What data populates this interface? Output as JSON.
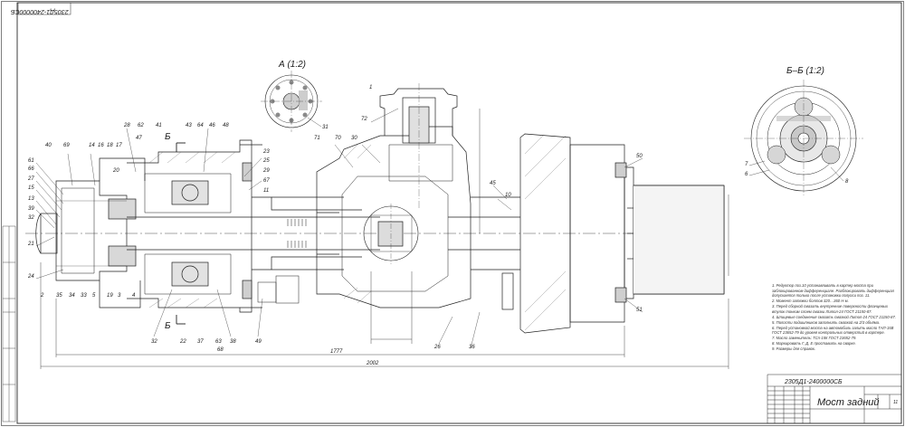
{
  "document": {
    "code_top": "2305Д1-2400000СБ",
    "code_titleblock": "2305Д1-2400000СБ",
    "title": "Мост задний",
    "sheets": "11"
  },
  "views": {
    "view_a": "А (1:2)",
    "view_bb": "Б–Б (1:2)",
    "section_mark": "Б"
  },
  "dimensions": {
    "d1": "1777",
    "d2": "2002"
  },
  "part_numbers": {
    "left_group": [
      "61",
      "66",
      "27",
      "15",
      "13",
      "39",
      "32",
      "21",
      "24"
    ],
    "top_left": [
      "40",
      "69",
      "14",
      "16",
      "18",
      "17",
      "20"
    ],
    "top_mid": [
      "28",
      "62",
      "47",
      "41",
      "43",
      "64",
      "46",
      "48"
    ],
    "right_mid": [
      "23",
      "25",
      "29",
      "67",
      "11"
    ],
    "bottom": [
      "2",
      "35",
      "34",
      "33",
      "5",
      "19",
      "3",
      "4"
    ],
    "bottom_mid": [
      "32",
      "22",
      "37",
      "63",
      "38",
      "68",
      "49"
    ],
    "diff": [
      "71",
      "70",
      "30",
      "72",
      "1"
    ],
    "right": [
      "45",
      "10",
      "50",
      "51",
      "26",
      "36"
    ],
    "view_a": [
      "31"
    ],
    "view_bb": [
      "7",
      "6",
      "8"
    ]
  },
  "notes": [
    "1. Редуктор поз.10 устанавливать в картер моста при заблокированном дифференциале. Разблокировать дифференциал допускается только после установки полуоси поз. 11.",
    "2. Момент затяжки болтов 320…360 Н·м.",
    "3. Перед сборкой смазать внутренние поверхности фланцевых втулок тонким слоем смазки Литол-24 ГОСТ 21150-87.",
    "4. Шлицевые соединения смазать смазкой Литол-24 ГОСТ 21150-87.",
    "5. Полости подшипников заполнить смазкой на 2/3 объёма.",
    "6. Перед установкой моста на автомобиль залить масло ТАП-15В ГОСТ 23652-79 до уровня контрольных отверстий в картере.",
    "7. Масло заменитель: ТСп-15К ГОСТ 23652-79.",
    "8. Маркировать Г, Д, Е проставить на сварке.",
    "9. Размеры для справок."
  ]
}
